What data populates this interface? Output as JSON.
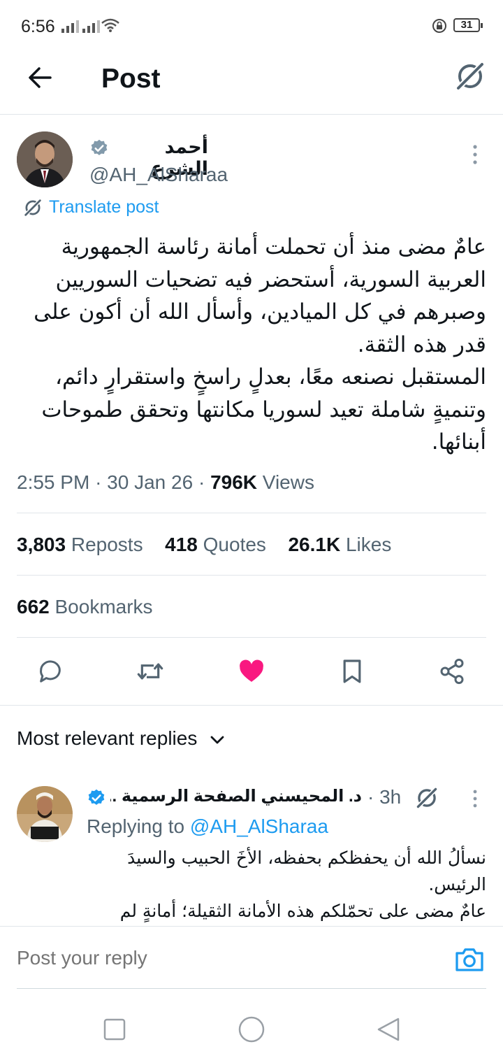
{
  "status_bar": {
    "time": "6:56",
    "battery": "31"
  },
  "header": {
    "title": "Post"
  },
  "post": {
    "author_name": "أحمد الشرع",
    "author_handle": "@AH_AlSharaa",
    "translate": "Translate post",
    "text_lines": [
      "عامٌ مضى منذ أن تحملت أمانة رئاسة الجمهورية",
      "العربية السورية، أستحضر فيه تضحيات السوريين",
      "وصبرهم في كل الميادين، وأسأل الله أن أكون على",
      "قدر هذه الثقة.",
      "المستقبل نصنعه معًا، بعدلٍ راسخٍ واستقرارٍ دائم،",
      "وتنميةٍ شاملة تعيد لسوريا مكانتها وتحقق طموحات",
      "أبنائها."
    ],
    "time": "2:55 PM",
    "date": "30 Jan 26",
    "views_count": "796K",
    "views_label": "Views"
  },
  "stats": {
    "reposts_count": "3,803",
    "reposts_label": "Reposts",
    "quotes_count": "418",
    "quotes_label": "Quotes",
    "likes_count": "26.1K",
    "likes_label": "Likes",
    "bookmarks_count": "662",
    "bookmarks_label": "Bookmarks"
  },
  "actions": {
    "reply_icon": "speech-bubble-icon",
    "repost_icon": "repost-arrows-icon",
    "like_icon": "heart-filled-icon",
    "bookmark_icon": "bookmark-icon",
    "share_icon": "share-icon",
    "like_color": "#f91880"
  },
  "replies": {
    "sort_label": "Most relevant replies",
    "items": [
      {
        "author_name": "د. المحيسني الصفحة الرسمية ...",
        "time": "3h",
        "replying_prefix": "Replying to",
        "replying_handle": "@AH_AlSharaa",
        "text_lines": [
          "نسألُ الله أن يحفظكم بحفظه، الأخَ الحبيب والسيدَ",
          "الرئيس.",
          "عامٌ مضى على تحمّلكم هذه الأمانة الثقيلة؛ أمانةٍ لم"
        ]
      }
    ]
  },
  "composer": {
    "placeholder": "Post your reply"
  },
  "colors": {
    "accent": "#1d9bf0",
    "muted": "#536471",
    "verified_blue": "#1d9bf0",
    "verified_gray": "#829aab"
  }
}
